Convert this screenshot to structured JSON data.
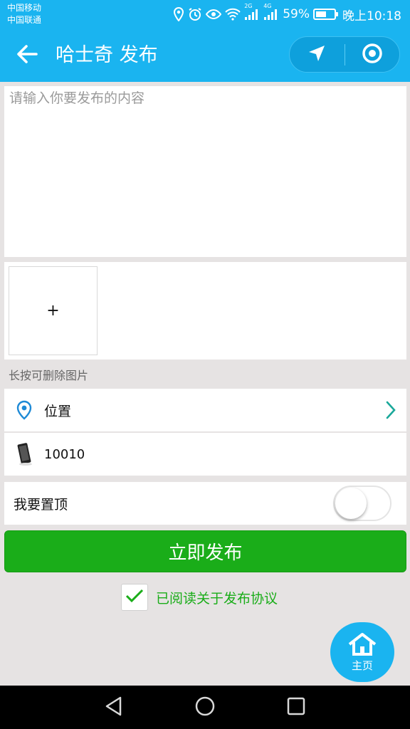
{
  "status_bar": {
    "carrier_1": "中国移动",
    "carrier_2": "中国联通",
    "signal_label_1": "2G",
    "signal_label_2": "4G",
    "battery_percent": "59%",
    "battery_level": 0.59,
    "time": "晚上10:18",
    "icons": [
      "location-icon",
      "alarm-icon",
      "eye-icon",
      "wifi-icon",
      "signal-icon",
      "signal-icon",
      "battery-icon"
    ]
  },
  "title_bar": {
    "title": "哈士奇 发布",
    "back_icon": "arrow-left-icon",
    "capsule_icons": [
      "navigation-arrow-icon",
      "target-circle-icon"
    ],
    "background_color": "#1ab4f0"
  },
  "content": {
    "placeholder": "请输入你要发布的内容",
    "value": ""
  },
  "image_upload": {
    "add_label": "+",
    "hint": "长按可删除图片"
  },
  "location_row": {
    "icon": "map-pin-icon",
    "label": "位置",
    "chevron": "chevron-right-icon"
  },
  "phone_row": {
    "icon": "phone-icon",
    "value": "10010"
  },
  "pin_row": {
    "label": "我要置顶",
    "toggle_on": false
  },
  "publish": {
    "label": "立即发布",
    "color": "#1aad19"
  },
  "agreement": {
    "checked": true,
    "label": "已阅读关于发布协议"
  },
  "home_fab": {
    "icon": "home-icon",
    "label": "主页"
  },
  "nav_bar": {
    "icons": [
      "back-triangle-icon",
      "home-circle-icon",
      "recents-square-icon"
    ]
  }
}
